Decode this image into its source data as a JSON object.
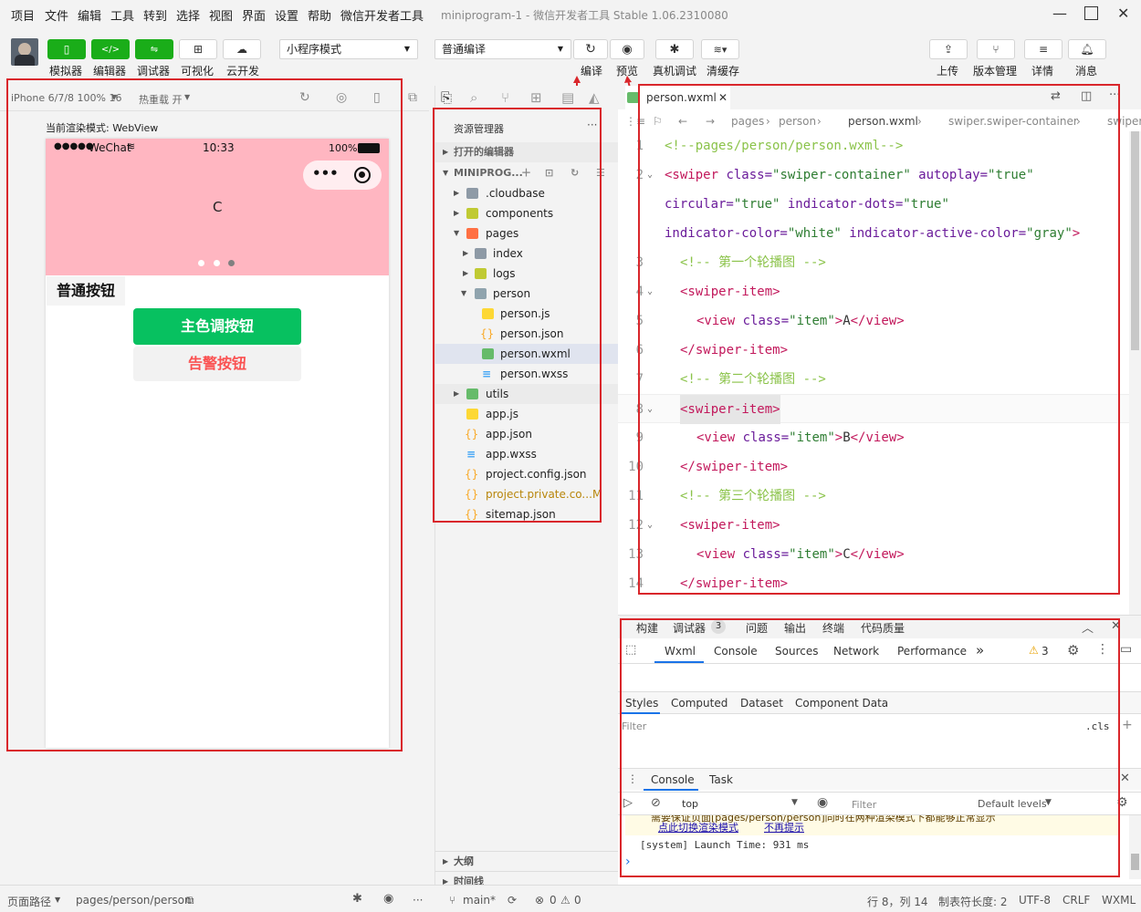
{
  "menu": {
    "items": [
      "项目",
      "文件",
      "编辑",
      "工具",
      "转到",
      "选择",
      "视图",
      "界面",
      "设置",
      "帮助",
      "微信开发者工具"
    ],
    "window_title": "miniprogram-1 - 微信开发者工具 Stable 1.06.2310080"
  },
  "toolbar": {
    "left_buttons": [
      "模拟器",
      "编辑器",
      "调试器",
      "可视化",
      "云开发"
    ],
    "mode_select": "小程序模式",
    "compile_select": "普通编译",
    "mid_buttons": [
      "编译",
      "预览",
      "真机调试",
      "清缓存"
    ],
    "right_buttons": [
      "上传",
      "版本管理",
      "详情",
      "消息"
    ]
  },
  "simulator": {
    "device": "iPhone 6/7/8 100% 16",
    "hot_reload": "热重载 开",
    "render_mode": "当前渲染模式: WebView",
    "status_dots": "●●●●●",
    "carrier": "WeChat",
    "time": "10:33",
    "battery": "100%",
    "swiper_text": "C",
    "section_label": "普通按钮",
    "primary_button": "主色调按钮",
    "warn_button": "告警按钮",
    "colors": {
      "swiper_bg": "#ffb6c1",
      "primary": "#07c160",
      "warn": "#fa5151"
    }
  },
  "explorer": {
    "title": "资源管理器",
    "open_editors": "打开的编辑器",
    "project": "MINIPROG...",
    "items": [
      ".cloudbase",
      "components",
      "pages",
      "index",
      "logs",
      "person",
      "person.js",
      "person.json",
      "person.wxml",
      "person.wxss",
      "utils",
      "app.js",
      "app.json",
      "app.wxss",
      "project.config.json",
      "project.private.co...",
      "sitemap.json"
    ],
    "modified_marker": "M",
    "outline": "大纲",
    "timeline": "时间线"
  },
  "editor": {
    "tab": "person.wxml",
    "breadcrumb": [
      "pages",
      "person",
      "person.wxml",
      "swiper.swiper-container",
      "swiper"
    ],
    "line_numbers": [
      "1",
      "2",
      "",
      "",
      "3",
      "4",
      "5",
      "6",
      "7",
      "8",
      "9",
      "10",
      "11",
      "12",
      "13",
      "14"
    ],
    "line1": "<!--pages/person/person.wxml-->",
    "line2a_tag": "<swiper",
    "line2a_attr1": " class=",
    "line2a_val1": "\"swiper-container\"",
    "line2a_attr2": " autoplay=",
    "line2a_val2": "\"true\"",
    "line2b_attr1": "circular=",
    "line2b_val1": "\"true\"",
    "line2b_attr2": " indicator-dots=",
    "line2b_val2": "\"true\"",
    "line2c_attr1": "indicator-color=",
    "line2c_val1": "\"white\"",
    "line2c_attr2": " indicator-active-color=",
    "line2c_val2": "\"gray\"",
    "line2c_end": ">",
    "comment1": "<!-- 第一个轮播图 -->",
    "comment2": "<!-- 第二个轮播图 -->",
    "comment3": "<!-- 第三个轮播图 -->",
    "open_item": "<swiper-item>",
    "close_item": "</swiper-item>",
    "view_open": "<view",
    "view_class": " class=",
    "view_val": "\"item\"",
    "view_gt": ">",
    "view_close": "</view>",
    "text_a": "A",
    "text_b": "B",
    "text_c": "C"
  },
  "devtools": {
    "top_tabs": [
      "构建",
      "调试器",
      "问题",
      "输出",
      "终端",
      "代码质量"
    ],
    "debug_badge": "3",
    "panels": [
      "Wxml",
      "Console",
      "Sources",
      "Network",
      "Performance"
    ],
    "more": "»",
    "warn_count": "3",
    "style_tabs": [
      "Styles",
      "Computed",
      "Dataset",
      "Component Data"
    ],
    "filter_placeholder": "Filter",
    "cls": ".cls",
    "console_tabs": [
      "Console",
      "Task"
    ],
    "context": "top",
    "filter2": "Filter",
    "levels": "Default levels",
    "warn_line": "需要保证页面[pages/person/person]同时在两种渲染模式下都能够正常显示",
    "link1": "点此切换渲染模式",
    "link2": "不再提示",
    "system_line": "[system] Launch Time: 931 ms",
    "prompt": "›"
  },
  "statusbar": {
    "page_path_label": "页面路径",
    "page_path": "pages/person/person",
    "branch": "main*",
    "errors": "0",
    "warnings": "0",
    "cursor": "行 8，列 14",
    "tab_size": "制表符长度: 2",
    "encoding": "UTF-8",
    "eol": "CRLF",
    "lang": "WXML"
  }
}
